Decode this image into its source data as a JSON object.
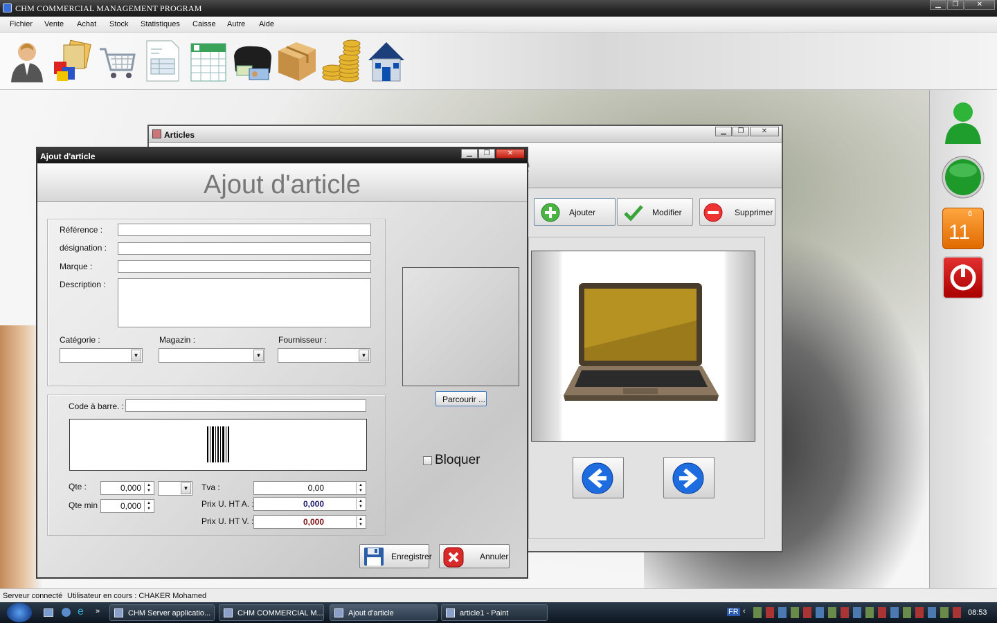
{
  "app": {
    "title": "CHM COMMERCIAL MANAGEMENT PROGRAM"
  },
  "window_controls": {
    "minimize": "▁",
    "restore": "❐",
    "close": "✕"
  },
  "menu": [
    "Fichier",
    "Vente",
    "Achat",
    "Stock",
    "Statistiques",
    "Caisse",
    "Autre",
    "Aide"
  ],
  "toolbar_icons": [
    "user-icon",
    "products-icon",
    "cart-icon",
    "invoice-icon",
    "spreadsheet-icon",
    "wallet-icon",
    "package-icon",
    "coins-icon",
    "home-icon"
  ],
  "articles_window": {
    "title": "Articles",
    "banner_fragment": "e",
    "buttons": {
      "add": "Ajouter",
      "edit": "Modifier",
      "delete": "Supprimer"
    }
  },
  "right_panel": {
    "calendar_month": "6",
    "calendar_day": "11"
  },
  "dialog": {
    "title": "Ajout d'article",
    "banner": "Ajout d'article",
    "labels": {
      "reference": "Référence :",
      "designation": "désignation :",
      "marque": "Marque :",
      "description": "Description :",
      "categorie": "Catégorie :",
      "magazin": "Magazin :",
      "fournisseur": "Fournisseur :",
      "code_barre": "Code à barre. :",
      "qte": "Qte :",
      "qte_min": "Qte min :",
      "tva": "Tva :",
      "prix_ht_a": "Prix U. HT A. :",
      "prix_ht_v": "Prix U. HT V. :"
    },
    "values": {
      "reference": "",
      "designation": "",
      "marque": "",
      "description": "",
      "code_barre": "",
      "qte": "0,000",
      "qte_min": "0,000",
      "tva": "0,00",
      "prix_ht_a": "0,000",
      "prix_ht_v": "0,000"
    },
    "browse_button": "Parcourir ...",
    "block_checkbox": "Bloquer",
    "save_button": "Enregistrer",
    "cancel_button": "Annuler",
    "colors": {
      "price_buy": "#1a1a6e",
      "price_sell": "#7a1010"
    }
  },
  "status": {
    "server": "Serveur connecté",
    "user": "Utilisateur en cours : CHAKER Mohamed"
  },
  "taskbar": {
    "tasks": [
      "CHM Server applicatio...",
      "CHM COMMERCIAL M...",
      "Ajout d'article",
      "article1 - Paint"
    ],
    "lang": "FR",
    "time": "08:53"
  }
}
